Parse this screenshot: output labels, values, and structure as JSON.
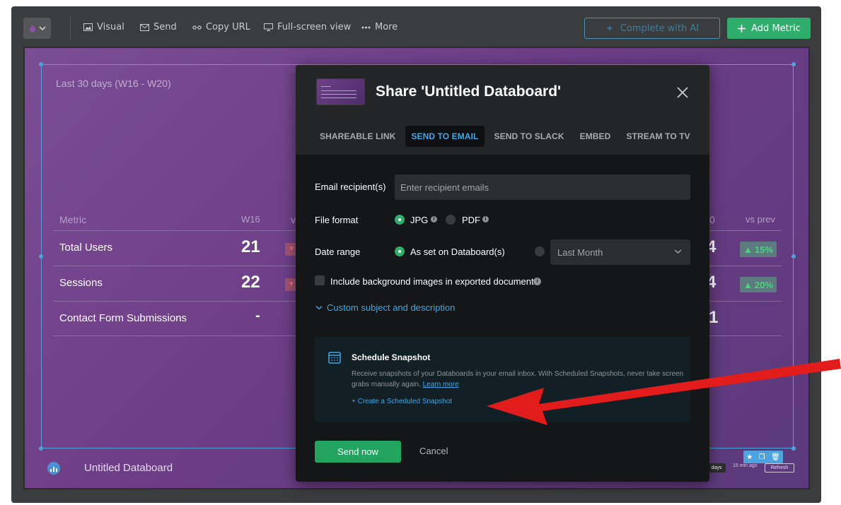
{
  "toolbar": {
    "visual": "Visual",
    "send": "Send",
    "copy_url": "Copy URL",
    "fullscreen": "Full-screen view",
    "more": "More",
    "ai": "Complete with AI",
    "add_metric": "Add Metric"
  },
  "databoard": {
    "period": "Last 30 days (W16 - W20)",
    "col_metric": "Metric",
    "col_w16": "W16",
    "col_vs": "v",
    "col_right": "0",
    "col_vs_prev": "vs prev",
    "rows": [
      {
        "name": "Total Users",
        "w16": "21",
        "right_value": "4",
        "change": "15%"
      },
      {
        "name": "Sessions",
        "w16": "22",
        "right_value": "4",
        "change": "20%"
      },
      {
        "name": "Contact Form Submissions",
        "w16": "-",
        "right_value": "1",
        "change": ""
      }
    ],
    "name": "Untitled Databoard",
    "days": "days",
    "updated": "15 min ago",
    "refresh": "Refresh"
  },
  "modal": {
    "title": "Share 'Untitled Databoard'",
    "tabs": [
      "SHAREABLE LINK",
      "SEND TO EMAIL",
      "SEND TO SLACK",
      "EMBED",
      "STREAM TO TV"
    ],
    "active_tab": "SEND TO EMAIL",
    "email_label": "Email recipient(s)",
    "email_placeholder": "Enter recipient emails",
    "format_label": "File format",
    "format_jpg": "JPG",
    "format_pdf": "PDF",
    "range_label": "Date range",
    "range_as_set": "As set on Databoard(s)",
    "range_select": "Last Month",
    "include_bg": "Include background images in exported document",
    "custom_subject": "Custom subject and description",
    "snapshot": {
      "title": "Schedule Snapshot",
      "desc": "Receive snapshots of your Databoards in your email inbox. With Scheduled Snapshots, never take screen grabs manually again.",
      "learn_more": "Learn more",
      "create": "+ Create a Scheduled Snapshot"
    },
    "send_now": "Send now",
    "cancel": "Cancel"
  },
  "colors": {
    "accent_green": "#2fae6b",
    "accent_blue": "#3ea7e6",
    "annotation_arrow": "#e21b1b"
  }
}
